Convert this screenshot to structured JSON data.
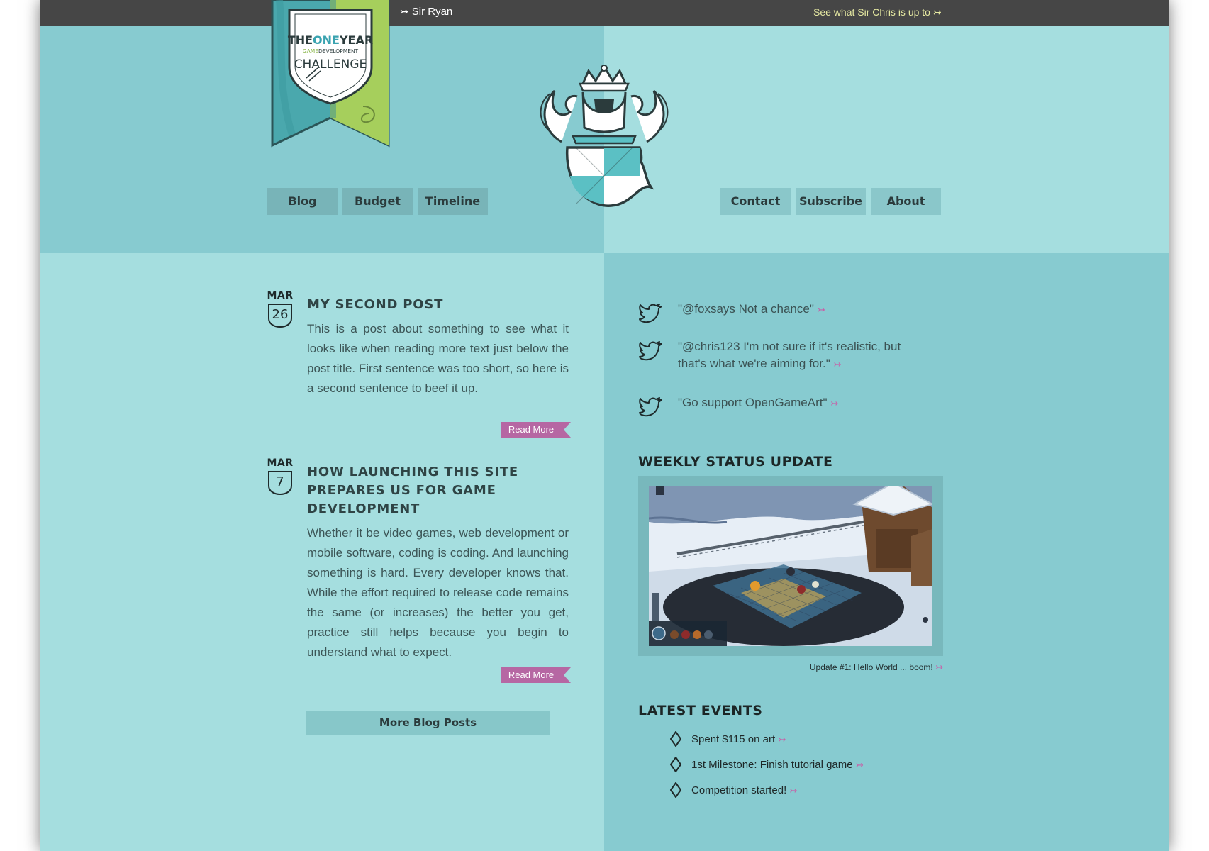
{
  "topbar": {
    "user_arrow": "↣",
    "user_name": "Sir Ryan",
    "other_link": "See what Sir Chris is up to ↣"
  },
  "logo": {
    "line1_a": "THE",
    "line1_b": "ONE",
    "line1_c": "YEAR",
    "line2_a": "GAME",
    "line2_b": "DEVELOPMENT",
    "line3": "CHALLENGE"
  },
  "nav_left": [
    "Blog",
    "Budget",
    "Timeline"
  ],
  "nav_right": [
    "Contact",
    "Subscribe",
    "About"
  ],
  "posts": [
    {
      "month": "MAR",
      "day": "26",
      "title": "My Second Post",
      "body": "This is a post about something to see what it looks like when reading more text just below the post title. First sentence was too short, so here is a second sentence to beef it up.",
      "read_more": "Read More"
    },
    {
      "month": "MAR",
      "day": "7",
      "title": "How Launching This Site Prepares Us for Game Development",
      "body": "Whether it be video games, web development or mobile software, coding is coding. And launching something is hard. Every developer knows that. While the effort required to release code remains the same (or increases) the better you get, practice still helps because you begin to understand what to expect.",
      "read_more": "Read More"
    }
  ],
  "more_posts": "More Blog Posts",
  "tweets": [
    {
      "text": "\"@foxsays Not a chance\"",
      "arrow": "↣"
    },
    {
      "text": "\"@chris123 I'm not sure if it's realistic, but that's what we're aiming for.\"",
      "arrow": "↣"
    },
    {
      "text": "\"Go support OpenGameArt\"",
      "arrow": "↣"
    }
  ],
  "weekly": {
    "title": "Weekly Status Update",
    "caption": "Update #1: Hello World ... boom!",
    "arrow": "↣"
  },
  "events": {
    "title": "Latest Events",
    "items": [
      {
        "label": "Spent $115 on art",
        "arrow": "↣"
      },
      {
        "label": "1st Milestone: Finish tutorial game",
        "arrow": "↣"
      },
      {
        "label": "Competition started!",
        "arrow": "↣"
      }
    ]
  },
  "colors": {
    "dark_teal": "#87cbd0",
    "light_teal": "#a5dedf",
    "topbar": "#464646",
    "accent_pink": "#b667a3",
    "link_yellow": "#e6e9a2"
  }
}
